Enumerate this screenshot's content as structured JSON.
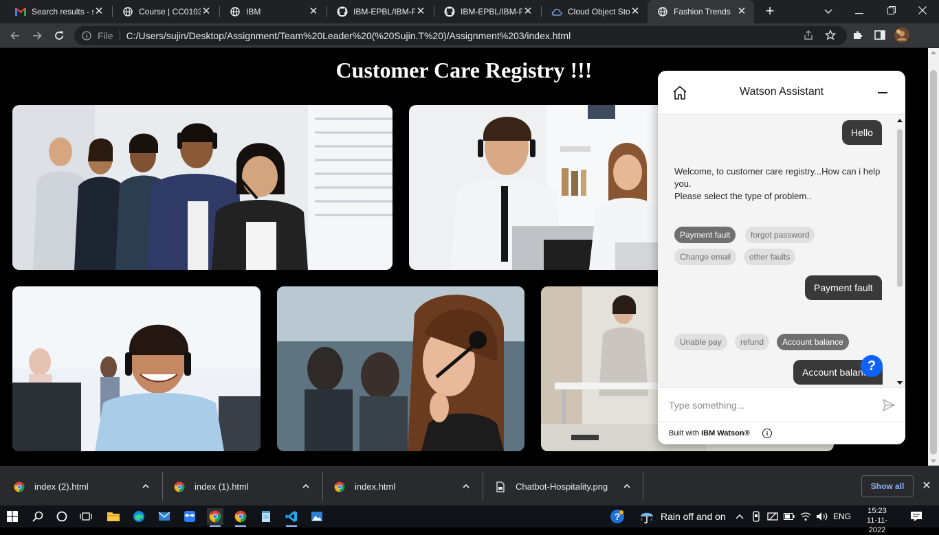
{
  "browser": {
    "tabs": [
      {
        "title": "Search results - s",
        "favicon": "gmail-icon",
        "active": false
      },
      {
        "title": "Course | CC0103E",
        "favicon": "globe-icon",
        "active": false
      },
      {
        "title": "IBM",
        "favicon": "globe-icon",
        "active": false
      },
      {
        "title": "IBM-EPBL/IBM-P",
        "favicon": "github-icon",
        "active": false
      },
      {
        "title": "IBM-EPBL/IBM-P",
        "favicon": "github-icon",
        "active": false
      },
      {
        "title": "Cloud Object Sto",
        "favicon": "cloud-icon",
        "active": false
      },
      {
        "title": "Fashion Trends",
        "favicon": "globe-icon",
        "active": true
      }
    ],
    "address": {
      "scheme": "File",
      "url": "C:/Users/sujin/Desktop/Assignment/Team%20Leader%20(%20Sujin.T%20)/Assignment%203/index.html"
    }
  },
  "page": {
    "title": "Customer Care Registry !!!"
  },
  "chat": {
    "header_title": "Watson Assistant",
    "messages": {
      "user_hello": "Hello",
      "bot_welcome_1": "Welcome, to customer care registry...How can i help you.",
      "bot_welcome_2": "Please select the type of problem..",
      "user_payment": "Payment fault",
      "user_account": "Account balance"
    },
    "options_1": [
      "Payment fault",
      "forgot password",
      "Change email",
      "other faults"
    ],
    "options_2": [
      "Unable pay",
      "refund",
      "Account balance"
    ],
    "help_label": "?",
    "input_placeholder": "Type something...",
    "footer_prefix": "Built with ",
    "footer_brand": "IBM Watson®",
    "accent_color": "#0f62fe"
  },
  "downloads": {
    "items": [
      "index (2).html",
      "index (1).html",
      "index.html",
      "Chatbot-Hospitality.png"
    ],
    "show_all": "Show all"
  },
  "taskbar": {
    "weather": "Rain off and on",
    "language": "ENG",
    "time": "15:23",
    "date": "11-11-2022"
  }
}
